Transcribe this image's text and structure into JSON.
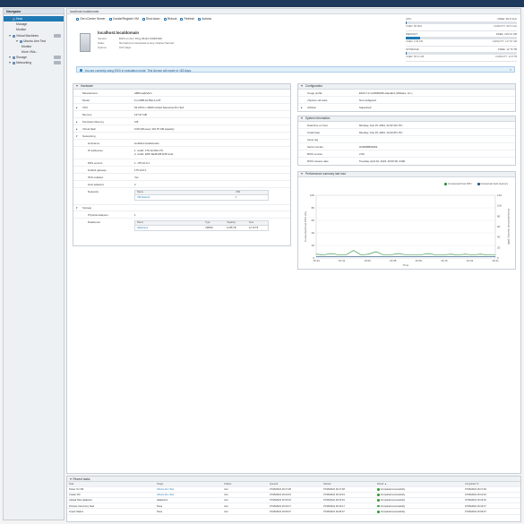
{
  "navigator": {
    "title": "Navigator",
    "items": [
      {
        "label": "Host",
        "level": 0,
        "active": true
      },
      {
        "label": "Manage",
        "level": 1
      },
      {
        "label": "Monitor",
        "level": 1
      },
      {
        "label": "Virtual Machines",
        "level": 0
      },
      {
        "label": "Ubuntu Arm Test",
        "level": 1
      },
      {
        "label": "Monitor",
        "level": 2
      },
      {
        "label": "More VMs...",
        "level": 2
      },
      {
        "label": "Storage",
        "level": 0
      },
      {
        "label": "Networking",
        "level": 0
      }
    ]
  },
  "main": {
    "title": "localhost.localdomain",
    "toolbar": [
      {
        "label": "Get vCenter Server",
        "icon": "vcenter-icon"
      },
      {
        "label": "Create/Register VM",
        "icon": "create-vm-icon"
      },
      {
        "label": "Shut down",
        "icon": "shutdown-icon"
      },
      {
        "label": "Reboot",
        "icon": "reboot-icon"
      },
      {
        "label": "Refresh",
        "icon": "refresh-icon"
      },
      {
        "label": "Actions",
        "icon": "gear-icon"
      }
    ],
    "host": {
      "name": "localhost.localdomain",
      "rows": [
        {
          "k": "Version:",
          "v": "ESXi on Arm Fling (Build 23948436)"
        },
        {
          "k": "State:",
          "v": "Normal (not connected to any vCenter Server)"
        },
        {
          "k": "Uptime:",
          "v": "0.07 days"
        }
      ]
    },
    "meters": [
      {
        "label": "CPU",
        "free": "FREE: 99.5 GHz",
        "pct": 0.01,
        "used": "USED: 58 MHz",
        "cap": "CAPACITY: 99.5 GHz"
      },
      {
        "label": "MEMORY",
        "free": "FREE: 125.01 GB",
        "pct": 0.13,
        "used": "USED: 2.96 GB",
        "cap": "CAPACITY: 127.97 GB"
      },
      {
        "label": "STORAGE",
        "free": "FREE: 12.76 TB",
        "pct": 0.01,
        "used": "USED: 56.41 GB",
        "cap": "CAPACITY: 12.8 TB"
      }
    ],
    "notice": "You are currently using ESXi in evaluation mode. This license will expire in 180 days."
  },
  "hardware": {
    "title": "Hardware",
    "rows": [
      {
        "k": "Manufacturer",
        "v": "AMPere(R)Arm"
      },
      {
        "k": "Model",
        "v": "1U-ORB-ALTRA-1-LZT"
      },
      {
        "k": "CPU",
        "v": "64 CPUs x ARM Limited Neoverse-N1 r3p1",
        "expand": true
      },
      {
        "k": "Memory",
        "v": "127.97 GB"
      },
      {
        "k": "Persistent Memory",
        "v": "0 B",
        "expand": true
      },
      {
        "k": "Virtual flash",
        "v": "0.69 GB used, 119.75 GB capacity",
        "expand": true
      },
      {
        "k": "Networking",
        "v": "",
        "expand": true
      }
    ],
    "networking_rows": [
      {
        "k": "Hostname",
        "v": "localhost.localdomain"
      },
      {
        "k": "IP addresses",
        "v": "1. vmk0: 175.10.254.175\n2. vmk0: fe80::8a45:f0ff:fe35:1c4c"
      },
      {
        "k": "DNS servers",
        "v": "1. 175.10.0.1"
      },
      {
        "k": "Default gateway",
        "v": "175.10.0.1"
      },
      {
        "k": "IPv6 enabled",
        "v": "Yes"
      },
      {
        "k": "Host adapters",
        "v": "2"
      }
    ],
    "networks_table": {
      "label": "Networks",
      "headers": [
        "Name",
        "VMs"
      ],
      "rows": [
        [
          "VM Network",
          "1"
        ]
      ]
    },
    "storage": {
      "label": "Storage",
      "physical_label": "Physical adapters",
      "physical_value": "1",
      "datastores_label": "Datastores",
      "headers": [
        "Name",
        "Type",
        "Capacity",
        "Free"
      ],
      "rows": [
        [
          "datastore1",
          "VMFS6",
          "12.85 TB",
          "12.79 TB"
        ]
      ]
    }
  },
  "configuration": {
    "title": "Configuration",
    "rows": [
      {
        "k": "Image profile",
        "v": "ESXi-7.0.4-23948436-standard (VMware, Inc.)"
      },
      {
        "k": "vSphere HA state",
        "v": "Not configured"
      },
      {
        "k": "vMotion",
        "v": "Supported",
        "expand": true
      }
    ]
  },
  "system_info": {
    "title": "System Information",
    "rows": [
      {
        "k": "Date/time on host",
        "v": "Monday, July 15, 2024, 22:32:19 UTC"
      },
      {
        "k": "Install date",
        "v": "Monday, July 15, 2024, 16:23:25 UTC"
      },
      {
        "k": "Asset tag",
        "v": ""
      },
      {
        "k": "Serial number",
        "v": "0C90R8506402"
      },
      {
        "k": "BIOS version",
        "v": "2.09"
      },
      {
        "k": "BIOS release date",
        "v": "Tuesday, April 19, 2024, 20:00:00 -0400"
      }
    ]
  },
  "performance": {
    "title": "Performance summary last hour",
    "legend_cpu": "Consumed host CPU",
    "legend_mem": "Consumed host memory",
    "legend_cpu_color": "#1b8a2e",
    "legend_mem_color": "#1f4e79",
    "ylabel_left": "Consumed host CPU (%)",
    "ylabel_right": "Consumed host memory (GB)",
    "xlabel": "Time"
  },
  "chart_data": {
    "type": "line",
    "x": [
      "15:33",
      "15:41",
      "15:50",
      "15:58",
      "16:06",
      "16:15",
      "16:23",
      "16:31"
    ],
    "ylim_left": [
      0,
      100
    ],
    "yticks_left": [
      0,
      20,
      40,
      60,
      80,
      100
    ],
    "ylim_right": [
      0,
      120
    ],
    "yticks_right": [
      0,
      20,
      40,
      60,
      80,
      100,
      120
    ],
    "xlabel": "Time",
    "series": [
      {
        "name": "Consumed host CPU",
        "axis": "left",
        "values": [
          6,
          5,
          7,
          5,
          5,
          12,
          5,
          6,
          10,
          5,
          5,
          7,
          5,
          5,
          5,
          7,
          5,
          5,
          6,
          5,
          6,
          5,
          6,
          5,
          5
        ]
      },
      {
        "name": "Consumed host memory",
        "axis": "right",
        "values": [
          2.9,
          2.9,
          2.9,
          2.9,
          2.9,
          2.9,
          2.9,
          2.9,
          2.9,
          2.9,
          2.9,
          2.9,
          2.9,
          2.9,
          2.9,
          2.9,
          2.9,
          2.9,
          2.9,
          2.9,
          2.9,
          2.9,
          2.9,
          2.9,
          2.9
        ]
      }
    ]
  },
  "recent_tasks": {
    "title": "Recent tasks",
    "headers": [
      "Task",
      "Target",
      "Initiator",
      "Queued",
      "Started",
      "Result ▲",
      "Completed ▼"
    ],
    "rows": [
      [
        "Power On VM",
        "Ubuntu Arm Test",
        "root",
        "07/15/2024 16:17:28",
        "07/15/2024 16:17:28",
        "Completed successfully",
        "07/15/2024 16:17:29"
      ],
      [
        "Create VM",
        "Ubuntu Arm Test",
        "root",
        "07/15/2024 16:10:43",
        "07/15/2024 16:10:43",
        "Completed successfully",
        "07/15/2024 16:10:43"
      ],
      [
        "Upload Files datastore",
        "datastore1",
        "root",
        "07/15/2024 16:15:15",
        "07/15/2024 16:15:15",
        "Completed successfully",
        "07/15/2024 16:15:15"
      ],
      [
        "Process Ceremony Task",
        "None",
        "root",
        "07/15/2024 16:16:17",
        "07/15/2024 16:16:17",
        "Completed successfully",
        "07/15/2024 16:16:17"
      ],
      [
        "Import Station",
        "None",
        "root",
        "07/15/2024 16:06:37",
        "07/15/2024 16:06:37",
        "Completed successfully",
        "07/15/2024 16:06:37"
      ]
    ]
  }
}
